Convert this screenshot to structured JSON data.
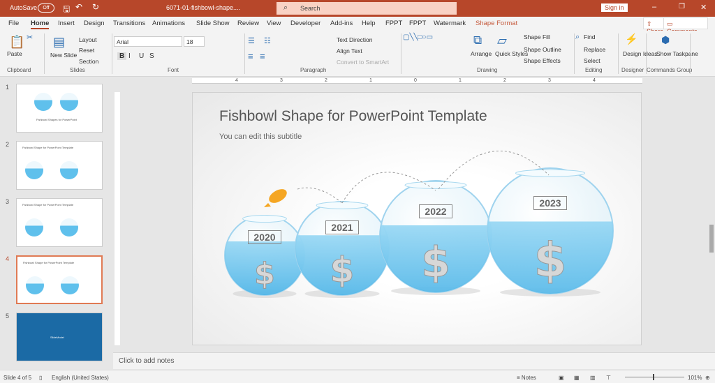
{
  "titlebar": {
    "autosave": "AutoSave",
    "toggle": "Off",
    "filename": "6071-01-fishbowl-shape....",
    "search_placeholder": "Search",
    "signin": "Sign in"
  },
  "tabs": [
    "File",
    "Home",
    "Insert",
    "Design",
    "Transitions",
    "Animations",
    "Slide Show",
    "Review",
    "View",
    "Developer",
    "Add-ins",
    "Help",
    "FPPT",
    "FPPT",
    "Watermark",
    "Shape Format"
  ],
  "share": "Share",
  "comments": "Comments",
  "ribbon": {
    "paste": "Paste",
    "new_slide": "New Slide",
    "layout": "Layout",
    "reset": "Reset",
    "section": "Section",
    "font_name": "Arial",
    "font_size": "18",
    "bold": "B",
    "italic": "I",
    "underline": "U",
    "strike": "S",
    "text_direction": "Text Direction",
    "align_text": "Align Text",
    "convert_smartart": "Convert to SmartArt",
    "arrange": "Arrange",
    "quick_styles": "Quick Styles",
    "shape_fill": "Shape Fill",
    "shape_outline": "Shape Outline",
    "shape_effects": "Shape Effects",
    "find": "Find",
    "replace": "Replace",
    "select": "Select",
    "design_ideas": "Design Ideas",
    "show_taskpane": "Show Taskpane",
    "groups": [
      "Clipboard",
      "Slides",
      "Font",
      "Paragraph",
      "Drawing",
      "Editing",
      "Designer",
      "Commands Group"
    ]
  },
  "thumbnails": [
    {
      "num": "1",
      "title": "Fishbowl Shapes for PowerPoint"
    },
    {
      "num": "2",
      "title": "Fishbowl Shape for PowerPoint Template"
    },
    {
      "num": "3",
      "title": "Fishbowl Shape for PowerPoint Template"
    },
    {
      "num": "4",
      "title": "Fishbowl Shape for PowerPoint Template",
      "selected": true
    },
    {
      "num": "5",
      "title": "SlideModel"
    }
  ],
  "ruler": [
    "4",
    "3",
    "2",
    "1",
    "0",
    "1",
    "2",
    "3",
    "4"
  ],
  "slide": {
    "title": "Fishbowl Shape for PowerPoint Template",
    "subtitle": "You can edit this subtitle",
    "years": [
      "2020",
      "2021",
      "2022",
      "2023"
    ]
  },
  "notes_placeholder": "Click to add notes",
  "status": {
    "slide": "Slide 4 of 5",
    "language": "English (United States)",
    "notes": "Notes",
    "zoom": "101%"
  },
  "colors": {
    "accent": "#b7472a",
    "water": "#3fb0e6",
    "fish": "#f5a623"
  }
}
